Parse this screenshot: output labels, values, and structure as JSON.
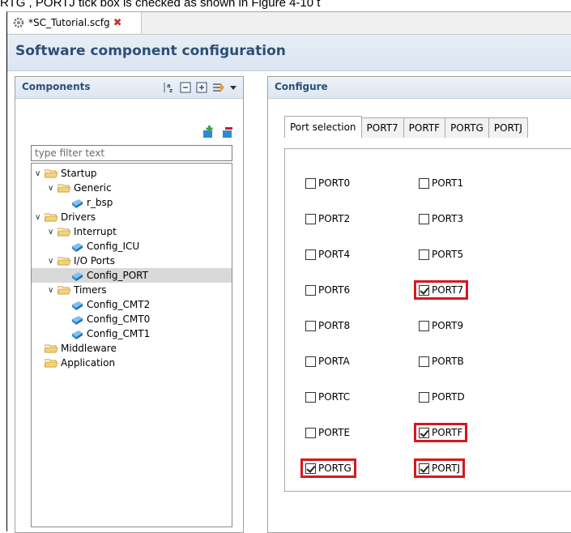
{
  "caption": "RTG , PORTJ tick box is checked as shown in Figure 4-10 t",
  "editor_tab": {
    "title": "*SC_Tutorial.scfg",
    "close_glyph": "✖"
  },
  "header": {
    "title": "Software component configuration"
  },
  "components": {
    "title": "Components",
    "filter_placeholder": "type filter text",
    "tree": [
      {
        "label": "Startup",
        "type": "folder",
        "expanded": true
      },
      {
        "label": "Generic",
        "type": "folder",
        "expanded": true
      },
      {
        "label": "r_bsp",
        "type": "component"
      },
      {
        "label": "Drivers",
        "type": "folder",
        "expanded": true
      },
      {
        "label": "Interrupt",
        "type": "folder",
        "expanded": true
      },
      {
        "label": "Config_ICU",
        "type": "component"
      },
      {
        "label": "I/O Ports",
        "type": "folder",
        "expanded": true
      },
      {
        "label": "Config_PORT",
        "type": "component",
        "selected": true
      },
      {
        "label": "Timers",
        "type": "folder",
        "expanded": true
      },
      {
        "label": "Config_CMT2",
        "type": "component"
      },
      {
        "label": "Config_CMT0",
        "type": "component"
      },
      {
        "label": "Config_CMT1",
        "type": "component"
      },
      {
        "label": "Middleware",
        "type": "folder"
      },
      {
        "label": "Application",
        "type": "folder"
      }
    ]
  },
  "configure": {
    "title": "Configure",
    "tabs": [
      "Port selection",
      "PORT7",
      "PORTF",
      "PORTG",
      "PORTJ"
    ],
    "active_tab": "Port selection",
    "ports": [
      {
        "label": "PORT0",
        "checked": false
      },
      {
        "label": "PORT1",
        "checked": false
      },
      {
        "label": "PORT2",
        "checked": false
      },
      {
        "label": "PORT3",
        "checked": false
      },
      {
        "label": "PORT4",
        "checked": false
      },
      {
        "label": "PORT5",
        "checked": false
      },
      {
        "label": "PORT6",
        "checked": false
      },
      {
        "label": "PORT7",
        "checked": true
      },
      {
        "label": "PORT8",
        "checked": false
      },
      {
        "label": "PORT9",
        "checked": false
      },
      {
        "label": "PORTA",
        "checked": false
      },
      {
        "label": "PORTB",
        "checked": false
      },
      {
        "label": "PORTC",
        "checked": false
      },
      {
        "label": "PORTD",
        "checked": false
      },
      {
        "label": "PORTE",
        "checked": false
      },
      {
        "label": "PORTF",
        "checked": true
      },
      {
        "label": "PORTG",
        "checked": true
      },
      {
        "label": "PORTJ",
        "checked": true
      }
    ]
  },
  "colors": {
    "highlight": "#d6181f",
    "header_text": "#2c4f76",
    "folder": "#e8c76a"
  }
}
